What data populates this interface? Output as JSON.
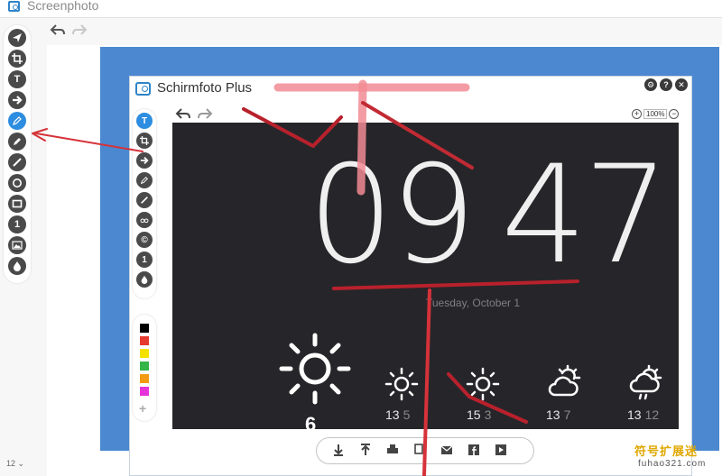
{
  "window": {
    "title": "Screenphoto",
    "zoom_level": "12"
  },
  "tools": [
    {
      "name": "share-icon",
      "glyph": ""
    },
    {
      "name": "crop-icon",
      "glyph": ""
    },
    {
      "name": "text-icon",
      "glyph": "T"
    },
    {
      "name": "arrow-icon",
      "glyph": ""
    },
    {
      "name": "pen-icon",
      "glyph": "",
      "active": true
    },
    {
      "name": "highlighter-icon",
      "glyph": ""
    },
    {
      "name": "pencil-icon",
      "glyph": ""
    },
    {
      "name": "circle-icon",
      "glyph": ""
    },
    {
      "name": "rectangle-icon",
      "glyph": ""
    },
    {
      "name": "number-icon",
      "glyph": "1"
    },
    {
      "name": "image-icon",
      "glyph": ""
    },
    {
      "name": "blur-icon",
      "glyph": ""
    }
  ],
  "capture": {
    "inner_title": "Schirmfoto Plus",
    "zoom": "100%",
    "zoom_plus": "+",
    "zoom_minus": "−",
    "buttons": {
      "settings": "⚙",
      "help": "?",
      "close": "✕"
    },
    "inner_tools": [
      {
        "name": "text-icon",
        "glyph": "T"
      },
      {
        "name": "crop-icon",
        "glyph": ""
      },
      {
        "name": "arrow-icon",
        "glyph": ""
      },
      {
        "name": "pen-icon",
        "glyph": ""
      },
      {
        "name": "pencil-icon",
        "glyph": ""
      },
      {
        "name": "mask-icon",
        "glyph": ""
      },
      {
        "name": "copyright-icon",
        "glyph": "©"
      },
      {
        "name": "number-icon",
        "glyph": "1"
      },
      {
        "name": "blur-icon",
        "glyph": ""
      }
    ],
    "palette": [
      "#000000",
      "#e53a2e",
      "#f5e100",
      "#35b54a",
      "#f29a12",
      "#e433d9"
    ],
    "palette_add": "+",
    "lockscreen": {
      "hours": "09",
      "minutes": "47",
      "date": "Tuesday, October 1",
      "current_temp": "6",
      "forecast": [
        {
          "icon": "sun-icon",
          "high": "13",
          "low": "5"
        },
        {
          "icon": "sun-icon",
          "high": "15",
          "low": "3"
        },
        {
          "icon": "partly-cloudy-icon",
          "high": "13",
          "low": "7"
        },
        {
          "icon": "showers-icon",
          "high": "13",
          "low": "12"
        }
      ]
    }
  },
  "colors": {
    "accent": "#2d8de0",
    "capture_bg": "#4b88d0",
    "screen_bg": "#26262a",
    "annotation": "#d6323a"
  },
  "watermark": {
    "line1": "符号扩展迷",
    "line2": "fuhao321.com"
  }
}
